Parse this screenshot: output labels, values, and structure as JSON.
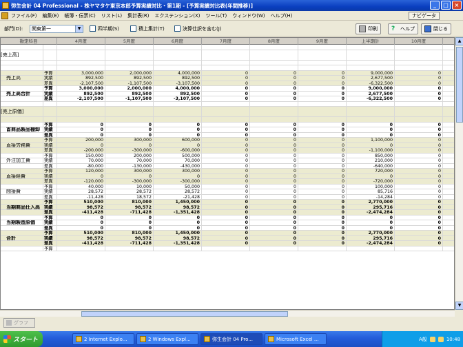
{
  "window": {
    "title": "弥生会計 04 Professional - 株ヤマタケ東京本郎予算実績対比・第1期 - [予算実績対比表(年間推移)]"
  },
  "menu": {
    "items": [
      "ファイル(F)",
      "編集(E)",
      "帳簿・伝票(C)",
      "リスト(L)",
      "集計表(R)",
      "エクステンション(X)",
      "ツール(T)",
      "ウィンドウ(W)",
      "ヘルプ(H)"
    ],
    "navi_label": "ナビゲータ"
  },
  "toolbar": {
    "dept_label": "部門(D):",
    "dept_value": "関東第一",
    "quarter_label": "四半期(S)",
    "cumulative_label": "積上集計(T)",
    "settlement_label": "決算仕訳を含む(J)",
    "print_label": "印刷",
    "help_label": "ヘルプ",
    "close_label": "閉じる"
  },
  "grid": {
    "columns": [
      "勘定科目",
      "4月度",
      "5月度",
      "6月度",
      "7月度",
      "8月度",
      "9月度",
      "上半期計",
      "10月度"
    ],
    "rows": [
      {
        "type": "blank"
      },
      {
        "type": "section",
        "label": "[売上高]"
      },
      {
        "type": "blank"
      },
      {
        "type": "blank"
      },
      {
        "type": "group",
        "label": "売上高",
        "shade": true,
        "bold": false,
        "lines": [
          {
            "kind": "予算",
            "values": [
              "3,000,000",
              "2,000,000",
              "4,000,000",
              "0",
              "0",
              "0",
              "9,000,000",
              "0"
            ]
          },
          {
            "kind": "実績",
            "values": [
              "892,500",
              "892,500",
              "892,500",
              "0",
              "0",
              "0",
              "2,677,500",
              "0"
            ]
          },
          {
            "kind": "差異",
            "values": [
              "-2,107,500",
              "-1,107,500",
              "-3,107,500",
              "0",
              "0",
              "0",
              "-6,322,500",
              "0"
            ]
          }
        ]
      },
      {
        "type": "group",
        "label": "売上高合計",
        "shade": false,
        "bold": true,
        "lines": [
          {
            "kind": "予算",
            "values": [
              "3,000,000",
              "2,000,000",
              "4,000,000",
              "0",
              "0",
              "0",
              "9,000,000",
              "0"
            ]
          },
          {
            "kind": "実績",
            "values": [
              "892,500",
              "892,500",
              "892,500",
              "0",
              "0",
              "0",
              "2,677,500",
              "0"
            ]
          },
          {
            "kind": "差異",
            "values": [
              "-2,107,500",
              "-1,107,500",
              "-3,107,500",
              "0",
              "0",
              "0",
              "-6,322,500",
              "0"
            ]
          }
        ]
      },
      {
        "type": "blank"
      },
      {
        "type": "section",
        "label": "[売上原価]",
        "shade": true
      },
      {
        "type": "blank",
        "shade": true
      },
      {
        "type": "group",
        "label": "首商品製品棚卸",
        "shade": false,
        "bold": true,
        "lines": [
          {
            "kind": "予算",
            "values": [
              "0",
              "0",
              "0",
              "0",
              "0",
              "0",
              "0",
              "0"
            ]
          },
          {
            "kind": "実績",
            "values": [
              "0",
              "0",
              "0",
              "0",
              "0",
              "0",
              "0",
              "0"
            ]
          },
          {
            "kind": "差異",
            "values": [
              "0",
              "0",
              "0",
              "0",
              "0",
              "0",
              "0",
              "0"
            ]
          }
        ]
      },
      {
        "type": "group",
        "label": "直接労務費",
        "shade": true,
        "bold": false,
        "lines": [
          {
            "kind": "予算",
            "values": [
              "200,000",
              "300,000",
              "600,000",
              "0",
              "0",
              "0",
              "1,100,000",
              "0"
            ]
          },
          {
            "kind": "実績",
            "values": [
              "0",
              "0",
              "0",
              "0",
              "0",
              "0",
              "0",
              "0"
            ]
          },
          {
            "kind": "差異",
            "values": [
              "-200,000",
              "-300,000",
              "-600,000",
              "0",
              "0",
              "0",
              "-1,100,000",
              "0"
            ]
          }
        ]
      },
      {
        "type": "group",
        "label": "外注加工費",
        "shade": false,
        "bold": false,
        "lines": [
          {
            "kind": "予算",
            "values": [
              "150,000",
              "200,000",
              "500,000",
              "0",
              "0",
              "0",
              "850,000",
              "0"
            ]
          },
          {
            "kind": "実績",
            "values": [
              "70,000",
              "70,000",
              "70,000",
              "0",
              "0",
              "0",
              "210,000",
              "0"
            ]
          },
          {
            "kind": "差異",
            "values": [
              "-80,000",
              "-130,000",
              "-430,000",
              "0",
              "0",
              "0",
              "-640,000",
              "0"
            ]
          }
        ]
      },
      {
        "type": "group",
        "label": "直接経費",
        "shade": true,
        "bold": false,
        "lines": [
          {
            "kind": "予算",
            "values": [
              "120,000",
              "300,000",
              "300,000",
              "0",
              "0",
              "0",
              "720,000",
              "0"
            ]
          },
          {
            "kind": "実績",
            "values": [
              "0",
              "0",
              "0",
              "0",
              "0",
              "0",
              "0",
              "0"
            ]
          },
          {
            "kind": "差異",
            "values": [
              "-120,000",
              "-300,000",
              "-300,000",
              "0",
              "0",
              "0",
              "-720,000",
              "0"
            ]
          }
        ]
      },
      {
        "type": "group",
        "label": "間接費",
        "shade": false,
        "bold": false,
        "lines": [
          {
            "kind": "予算",
            "values": [
              "40,000",
              "10,000",
              "50,000",
              "0",
              "0",
              "0",
              "100,000",
              "0"
            ]
          },
          {
            "kind": "実績",
            "values": [
              "28,572",
              "28,572",
              "28,572",
              "0",
              "0",
              "0",
              "85,716",
              "0"
            ]
          },
          {
            "kind": "差異",
            "values": [
              "-11,428",
              "18,572",
              "-21,428",
              "0",
              "0",
              "0",
              "-14,284",
              "0"
            ]
          }
        ]
      },
      {
        "type": "group",
        "label": "当期商品仕入高",
        "shade": true,
        "bold": true,
        "lines": [
          {
            "kind": "予算",
            "values": [
              "510,000",
              "810,000",
              "1,450,000",
              "0",
              "0",
              "0",
              "2,770,000",
              "0"
            ]
          },
          {
            "kind": "実績",
            "values": [
              "98,572",
              "98,572",
              "98,572",
              "0",
              "0",
              "0",
              "295,716",
              "0"
            ]
          },
          {
            "kind": "差異",
            "values": [
              "-411,428",
              "-711,428",
              "-1,351,428",
              "0",
              "0",
              "0",
              "-2,474,284",
              "0"
            ]
          }
        ]
      },
      {
        "type": "group",
        "label": "当期製造原価",
        "shade": false,
        "bold": true,
        "lines": [
          {
            "kind": "予算",
            "values": [
              "0",
              "0",
              "0",
              "0",
              "0",
              "0",
              "0",
              "0"
            ]
          },
          {
            "kind": "実績",
            "values": [
              "0",
              "0",
              "0",
              "0",
              "0",
              "0",
              "0",
              "0"
            ]
          },
          {
            "kind": "差異",
            "values": [
              "0",
              "0",
              "0",
              "0",
              "0",
              "0",
              "0",
              "0"
            ]
          }
        ]
      },
      {
        "type": "group",
        "label": "合計",
        "shade": true,
        "bold": true,
        "lines": [
          {
            "kind": "予算",
            "values": [
              "510,000",
              "810,000",
              "1,450,000",
              "0",
              "0",
              "0",
              "2,770,000",
              "0"
            ]
          },
          {
            "kind": "実績",
            "values": [
              "98,572",
              "98,572",
              "98,572",
              "0",
              "0",
              "0",
              "295,716",
              "0"
            ]
          },
          {
            "kind": "差異",
            "values": [
              "-411,428",
              "-711,428",
              "-1,351,428",
              "0",
              "0",
              "0",
              "-2,474,284",
              "0"
            ]
          }
        ]
      },
      {
        "type": "partial",
        "kind": "予算"
      }
    ]
  },
  "status": {
    "graph_label": "グラフ"
  },
  "taskbar": {
    "start_label": "スタート",
    "tasks": [
      {
        "label": "2 Internet Explo...",
        "active": false
      },
      {
        "label": "2 Windows Expl...",
        "active": false
      },
      {
        "label": "弥生会計 04 Pro...",
        "active": true
      },
      {
        "label": "Microsoft Excel ...",
        "active": false
      }
    ],
    "ime_label": "A般",
    "clock": "10:48"
  }
}
